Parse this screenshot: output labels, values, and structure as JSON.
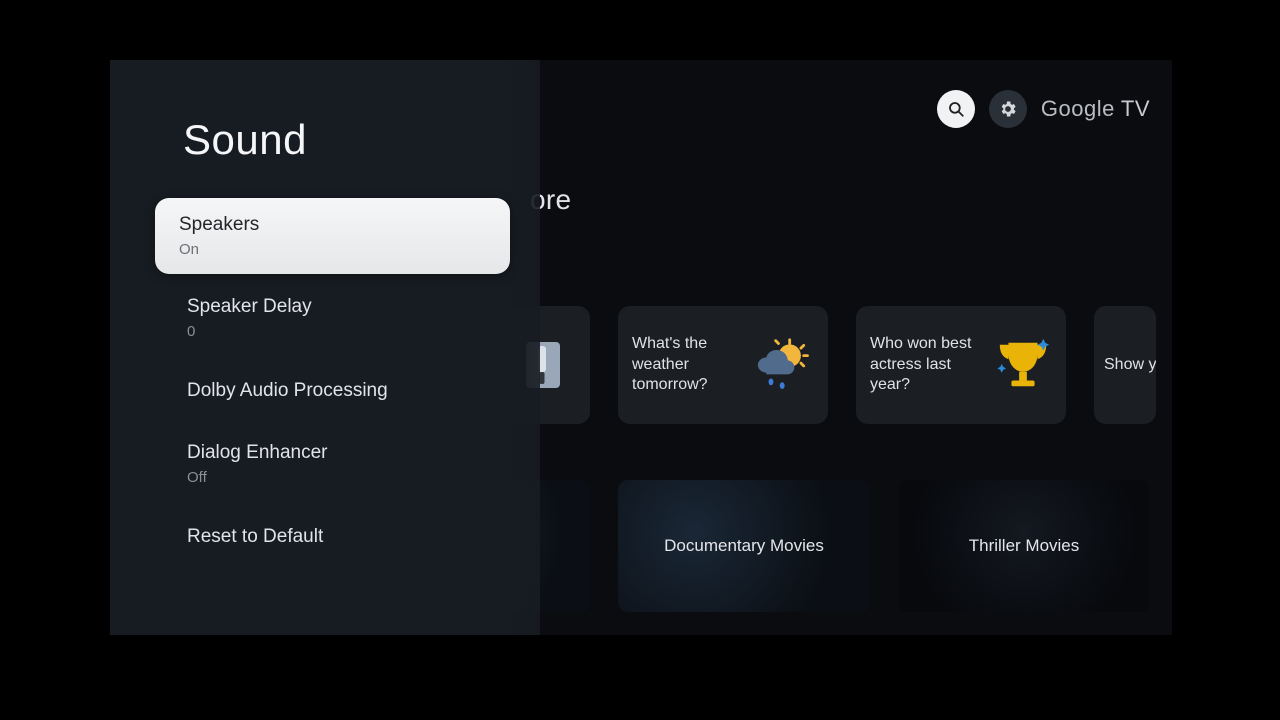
{
  "topbar": {
    "brand_a": "Google",
    "brand_b": "TV"
  },
  "home": {
    "section_tail": "ore",
    "cards": [
      {
        "text": "What's the weather tomorrow?"
      },
      {
        "text": "Who won best actress last year?"
      },
      {
        "text": "Show yoga"
      }
    ],
    "thumbs": [
      {
        "label": "Documentary Movies"
      },
      {
        "label": "Thriller Movies"
      }
    ]
  },
  "panel": {
    "title": "Sound",
    "items": [
      {
        "label": "Speakers",
        "sub": "On",
        "selected": true
      },
      {
        "label": "Speaker Delay",
        "sub": "0"
      },
      {
        "label": "Dolby Audio Processing"
      },
      {
        "label": "Dialog Enhancer",
        "sub": "Off"
      },
      {
        "label": "Reset to Default"
      }
    ]
  }
}
